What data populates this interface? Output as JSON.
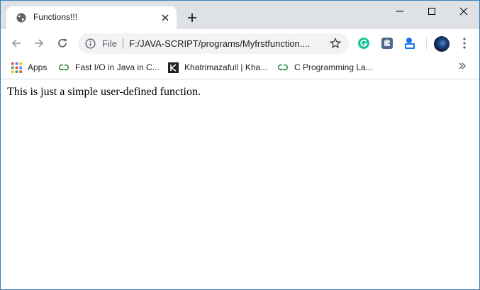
{
  "tab": {
    "title": "Functions!!!"
  },
  "omnibox": {
    "scheme": "File",
    "url": "F:/JAVA-SCRIPT/programs/Myfrstfunction...."
  },
  "bookmarks": [
    {
      "label": "Apps",
      "icon": "apps-grid-icon"
    },
    {
      "label": "Fast I/O in Java in C...",
      "icon": "gfg-icon"
    },
    {
      "label": "Khatrimazafull | Kha...",
      "icon": "k-logo-icon"
    },
    {
      "label": "C Programming La...",
      "icon": "gfg-icon"
    }
  ],
  "page": {
    "text": "This is just a simple user-defined function."
  },
  "colors": {
    "tabstrip": "#dee1e6",
    "omnibox": "#f1f3f4",
    "gfg_green": "#2f8d46",
    "grammarly": "#15c39a"
  }
}
